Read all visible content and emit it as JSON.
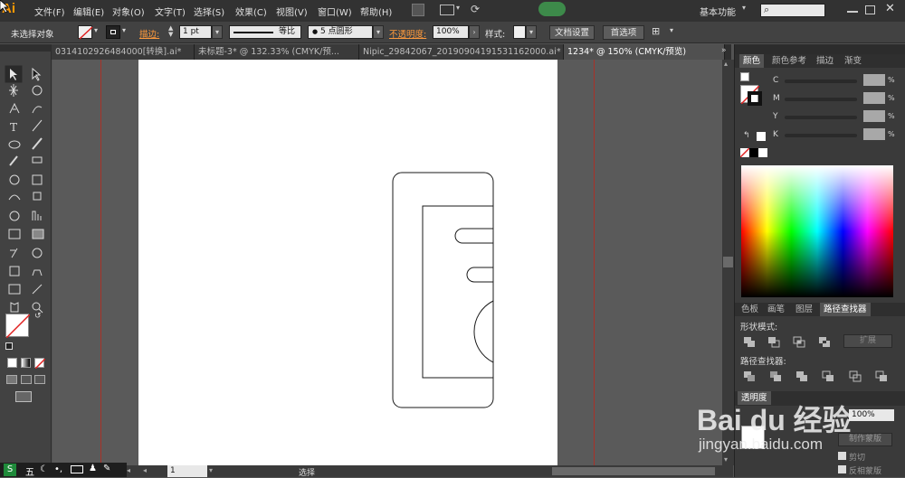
{
  "app": {
    "logo": "Ai"
  },
  "menu": [
    "文件(F)",
    "编辑(E)",
    "对象(O)",
    "文字(T)",
    "选择(S)",
    "效果(C)",
    "视图(V)",
    "窗口(W)",
    "帮助(H)"
  ],
  "workspace": {
    "label": "基本功能"
  },
  "control_bar": {
    "selection_status": "未选择对象",
    "stroke_label": "描边:",
    "stroke_weight": "1 pt",
    "stroke_profile": "等比",
    "brush": "5 点圆形",
    "opacity_label": "不透明度:",
    "opacity_value": "100%",
    "style_label": "样式:",
    "doc_setup_button": "文档设置",
    "preferences_button": "首选项"
  },
  "tabs": [
    {
      "label": "0314102926484000[转换].ai*",
      "active": false
    },
    {
      "label": "未标题-3* @ 132.33% (CMYK/预...",
      "active": false
    },
    {
      "label": "Nipic_29842067_20190904191531162000.ai*",
      "active": false
    },
    {
      "label": "1234* @ 150% (CMYK/预览)",
      "active": true
    }
  ],
  "color_panel": {
    "tabs": [
      "颜色",
      "颜色参考",
      "描边",
      "渐变"
    ],
    "channels": [
      {
        "name": "C",
        "unit": "%"
      },
      {
        "name": "M",
        "unit": "%"
      },
      {
        "name": "Y",
        "unit": "%"
      },
      {
        "name": "K",
        "unit": "%"
      }
    ]
  },
  "pathfinder_panel": {
    "tabs": [
      "色板",
      "画笔",
      "图层",
      "路径查找器"
    ],
    "shape_modes_label": "形状模式:",
    "expand_button": "扩展",
    "pathfinders_label": "路径查找器:"
  },
  "transparency_panel": {
    "tab": "透明度",
    "opacity_value": "100%",
    "make_mask_button": "制作蒙版",
    "clip_label": "剪切",
    "invert_mask_label": "反相蒙版"
  },
  "status_bar": {
    "zoom": "1",
    "tool_label": "选择"
  },
  "taskbar": {
    "ime_label": "五"
  },
  "watermark": {
    "brand": "Bai du 经验",
    "url": "jingyan.baidu.com"
  },
  "colors": {
    "accent": "#ff9a00",
    "artboard": "#ffffff",
    "guide": "#c0392b",
    "panel_bg": "#3a3a3a"
  }
}
